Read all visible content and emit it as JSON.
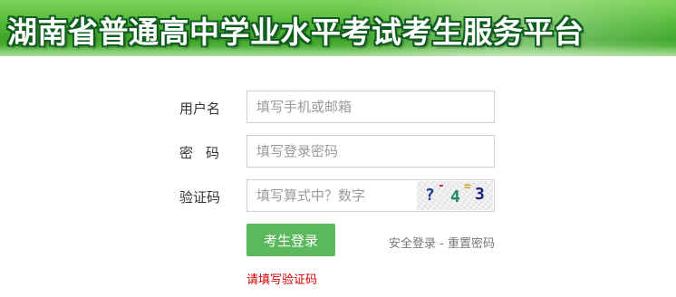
{
  "header": {
    "title": "湖南省普通高中学业水平考试考生服务平台"
  },
  "form": {
    "username": {
      "label": "用户名",
      "placeholder": "填写手机或邮箱"
    },
    "password": {
      "label": "密码",
      "placeholder": "填写登录密码"
    },
    "captcha": {
      "label": "验证码",
      "placeholder": "填写算式中？数字",
      "image_chars": [
        "?",
        "-",
        "4",
        "=",
        "3"
      ],
      "image_colors": [
        "#1a3a8a",
        "#c21e56",
        "#1f8a6a",
        "#caa020",
        "#1a237e"
      ]
    },
    "login_button": "考生登录",
    "links": {
      "safe_login": "安全登录",
      "separator": "-",
      "reset_password": "重置密码"
    },
    "error_message": "请填写验证码"
  },
  "colors": {
    "banner_green": "#4fb636",
    "button_green": "#5cb85c",
    "error_red": "#d10000"
  }
}
